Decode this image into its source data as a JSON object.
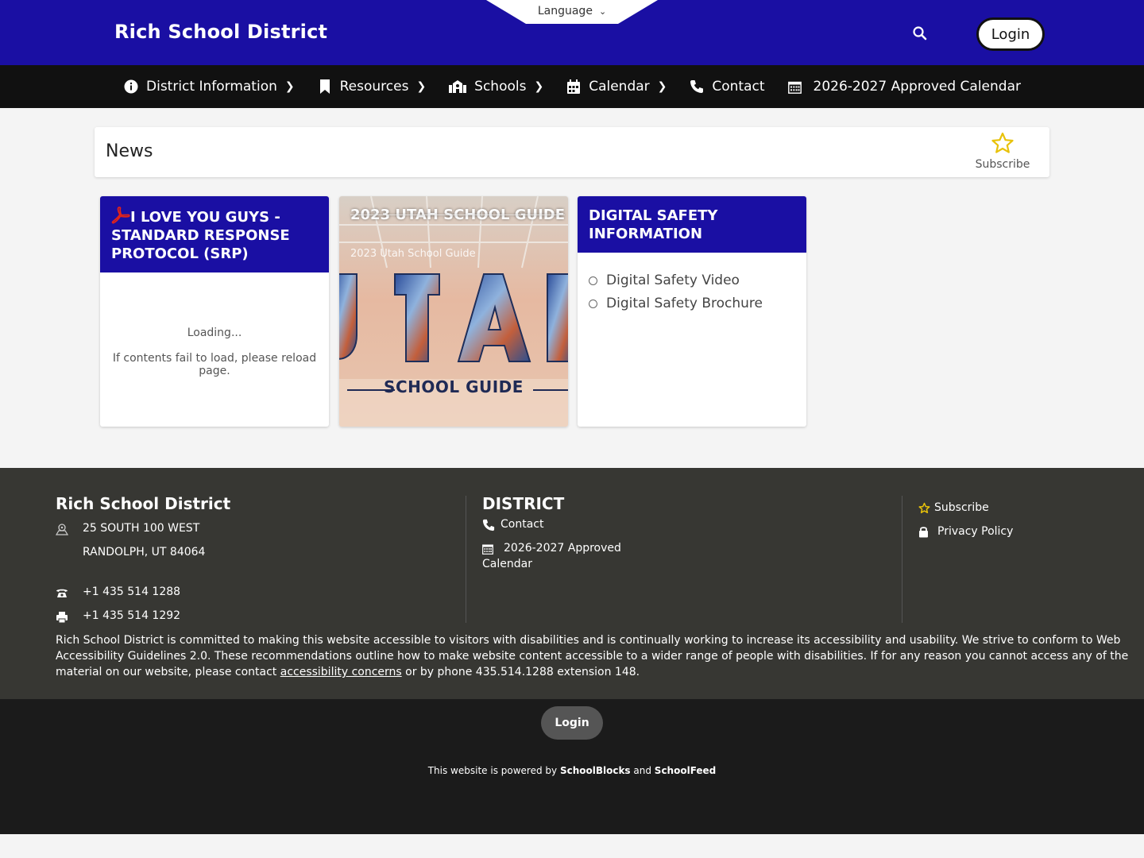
{
  "header": {
    "site_title": "Rich School District",
    "language_label": "Language",
    "login_label": "Login"
  },
  "nav": {
    "items": [
      {
        "label": "District Information",
        "icon": "info-circle-icon",
        "has_submenu": true
      },
      {
        "label": "Resources",
        "icon": "bookmark-icon",
        "has_submenu": true
      },
      {
        "label": "Schools",
        "icon": "school-icon",
        "has_submenu": true
      },
      {
        "label": "Calendar",
        "icon": "calendar-icon",
        "has_submenu": true
      },
      {
        "label": "Contact",
        "icon": "phone-icon",
        "has_submenu": false
      },
      {
        "label": "2026-2027 Approved Calendar",
        "icon": "calendar-grid-icon",
        "has_submenu": false
      }
    ]
  },
  "news": {
    "title": "News",
    "subscribe_label": "Subscribe"
  },
  "cards": {
    "srp": {
      "title": "I LOVE YOU GUYS - STANDARD RESPONSE PROTOCOL (SRP)",
      "loading": "Loading...",
      "reload_note": "If contents fail to load, please reload page."
    },
    "guide": {
      "title": "2023 UTAH SCHOOL GUIDE",
      "subtitle": "2023 Utah School Guide",
      "image_letters": "UTAH",
      "image_caption": "SCHOOL GUIDE"
    },
    "digital": {
      "title": "DIGITAL SAFETY INFORMATION",
      "links": [
        "Digital Safety Video",
        "Digital Safety Brochure"
      ]
    }
  },
  "footer": {
    "org_name": "Rich School District",
    "address_line1": "25 SOUTH 100 WEST",
    "address_line2": "RANDOLPH, UT 84064",
    "phone": "+1 435 514 1288",
    "fax": "+1 435 514 1292",
    "district_heading": "DISTRICT",
    "district_links": [
      "Contact",
      "2026-2027 Approved",
      "Calendar"
    ],
    "right_links": [
      "Subscribe",
      "Privacy Policy"
    ],
    "accessibility_text": "Rich School District is committed to making this website accessible to visitors with disabilities and is continually working to increase its accessibility and usability. We strive to conform to Web Accessibility Guidelines 2.0. These recommendations outline how to make website content accessible to a wider range of people with disabilities. If for any reason you cannot access any of the material on our website, please contact ",
    "accessibility_link": "accessibility concerns",
    "accessibility_tail": " or by phone 435.514.1288 extension 148."
  },
  "bottom": {
    "login_label": "Login",
    "powered_prefix": "This website is powered by ",
    "powered_brand1": "SchoolBlocks",
    "powered_and": " and ",
    "powered_brand2": "SchoolFeed"
  },
  "colors": {
    "brand_blue": "#1a0fa3",
    "nav_black": "#111111",
    "footer_gray": "#373733",
    "star_yellow": "#e8c20a",
    "pdf_red": "#e2231a"
  }
}
